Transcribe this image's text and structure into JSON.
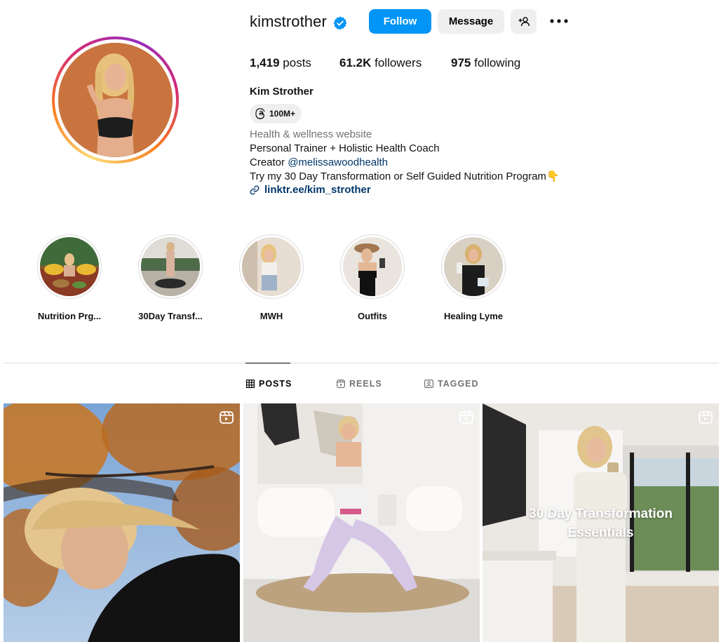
{
  "profile": {
    "username": "kimstrother",
    "verified": true,
    "follow_label": "Follow",
    "message_label": "Message",
    "stats": {
      "posts_count": "1,419",
      "posts_label": "posts",
      "followers_count": "61.2K",
      "followers_label": "followers",
      "following_count": "975",
      "following_label": "following"
    },
    "full_name": "Kim Strother",
    "threads_badge": "100M+",
    "category": "Health & wellness website",
    "bio_line1": "Personal Trainer + Holistic Health Coach",
    "bio_line2_prefix": "Creator ",
    "bio_line2_mention": "@melissawoodhealth",
    "bio_line3": "Try my 30 Day Transformation or Self Guided Nutrition Program",
    "bio_line3_emoji": "👇",
    "link": "linktr.ee/kim_strother"
  },
  "highlights": [
    {
      "label": "Nutrition Prg..."
    },
    {
      "label": "30Day Transf..."
    },
    {
      "label": "MWH"
    },
    {
      "label": "Outfits"
    },
    {
      "label": "Healing Lyme"
    }
  ],
  "tabs": {
    "posts": "POSTS",
    "reels": "REELS",
    "tagged": "TAGGED",
    "active": "posts"
  },
  "posts": [
    {
      "overlay_text": ""
    },
    {
      "overlay_text": ""
    },
    {
      "overlay_text_line1": "30 Day Transformation",
      "overlay_text_line2": "Essentials"
    }
  ],
  "colors": {
    "accent": "#0095f6",
    "link": "#00376b",
    "muted": "#737373",
    "button_gray": "#efefef"
  }
}
